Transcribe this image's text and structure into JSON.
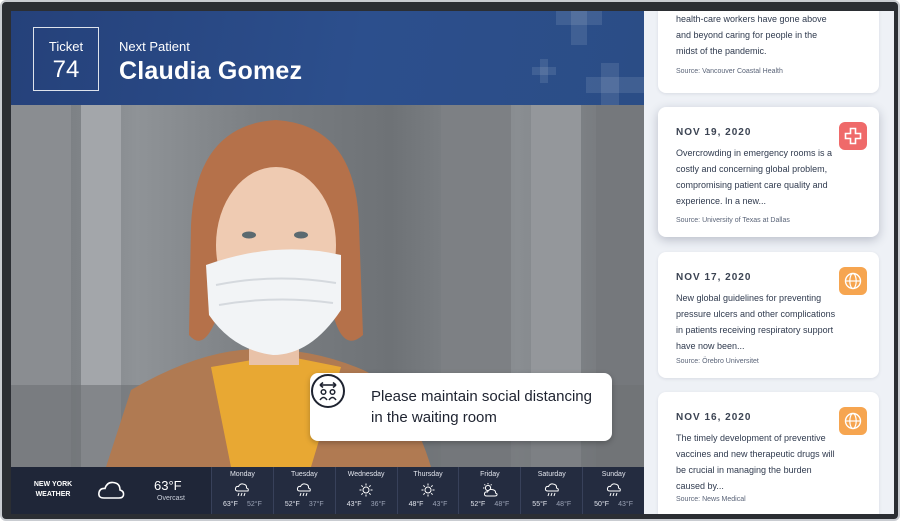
{
  "header": {
    "ticket_label": "Ticket",
    "ticket_number": "74",
    "next_label": "Next Patient",
    "patient_name": "Claudia Gomez"
  },
  "notice": {
    "icon": "social-distancing-icon",
    "text": "Please maintain social distancing in the waiting room"
  },
  "weather": {
    "city": "NEW YORK WEATHER",
    "current_icon": "cloud-icon",
    "current_temp": "63°F",
    "current_condition": "Overcast",
    "days": [
      {
        "name": "Monday",
        "icon": "rain-icon",
        "hi": "63°F",
        "lo": "52°F"
      },
      {
        "name": "Tuesday",
        "icon": "rain-icon",
        "hi": "52°F",
        "lo": "37°F"
      },
      {
        "name": "Wednesday",
        "icon": "sun-icon",
        "hi": "43°F",
        "lo": "36°F"
      },
      {
        "name": "Thursday",
        "icon": "sun-icon",
        "hi": "48°F",
        "lo": "43°F"
      },
      {
        "name": "Friday",
        "icon": "partly-cloudy-icon",
        "hi": "52°F",
        "lo": "48°F"
      },
      {
        "name": "Saturday",
        "icon": "rain-icon",
        "hi": "55°F",
        "lo": "48°F"
      },
      {
        "name": "Sunday",
        "icon": "rain-icon",
        "hi": "50°F",
        "lo": "43°F"
      }
    ]
  },
  "news": [
    {
      "date": "",
      "body": "health-care workers have gone above and beyond caring for people in the midst of the pandemic.",
      "source": "Source: Vancouver Coastal Health",
      "badge": ""
    },
    {
      "date": "NOV 19, 2020",
      "body": "Overcrowding in emergency rooms is a costly and concerning global problem, compromising patient care quality and experience. In a new...",
      "source": "Source: University of Texas at Dallas",
      "badge": "medical-cross-icon"
    },
    {
      "date": "NOV 17, 2020",
      "body": "New global guidelines for preventing pressure ulcers and other complications in patients receiving respiratory support have now been...",
      "source": "Source: Örebro Universitet",
      "badge": "globe-icon"
    },
    {
      "date": "NOV 16, 2020",
      "body": "The timely development of preventive vaccines and new therapeutic drugs will be crucial in managing the burden caused by...",
      "source": "Source: News Medical",
      "badge": "globe-icon"
    }
  ],
  "colors": {
    "header_blue": "#2c4f8d",
    "weather_bar": "#1f2638",
    "badge_red": "#ef6a6a",
    "badge_orange": "#f6a550"
  }
}
